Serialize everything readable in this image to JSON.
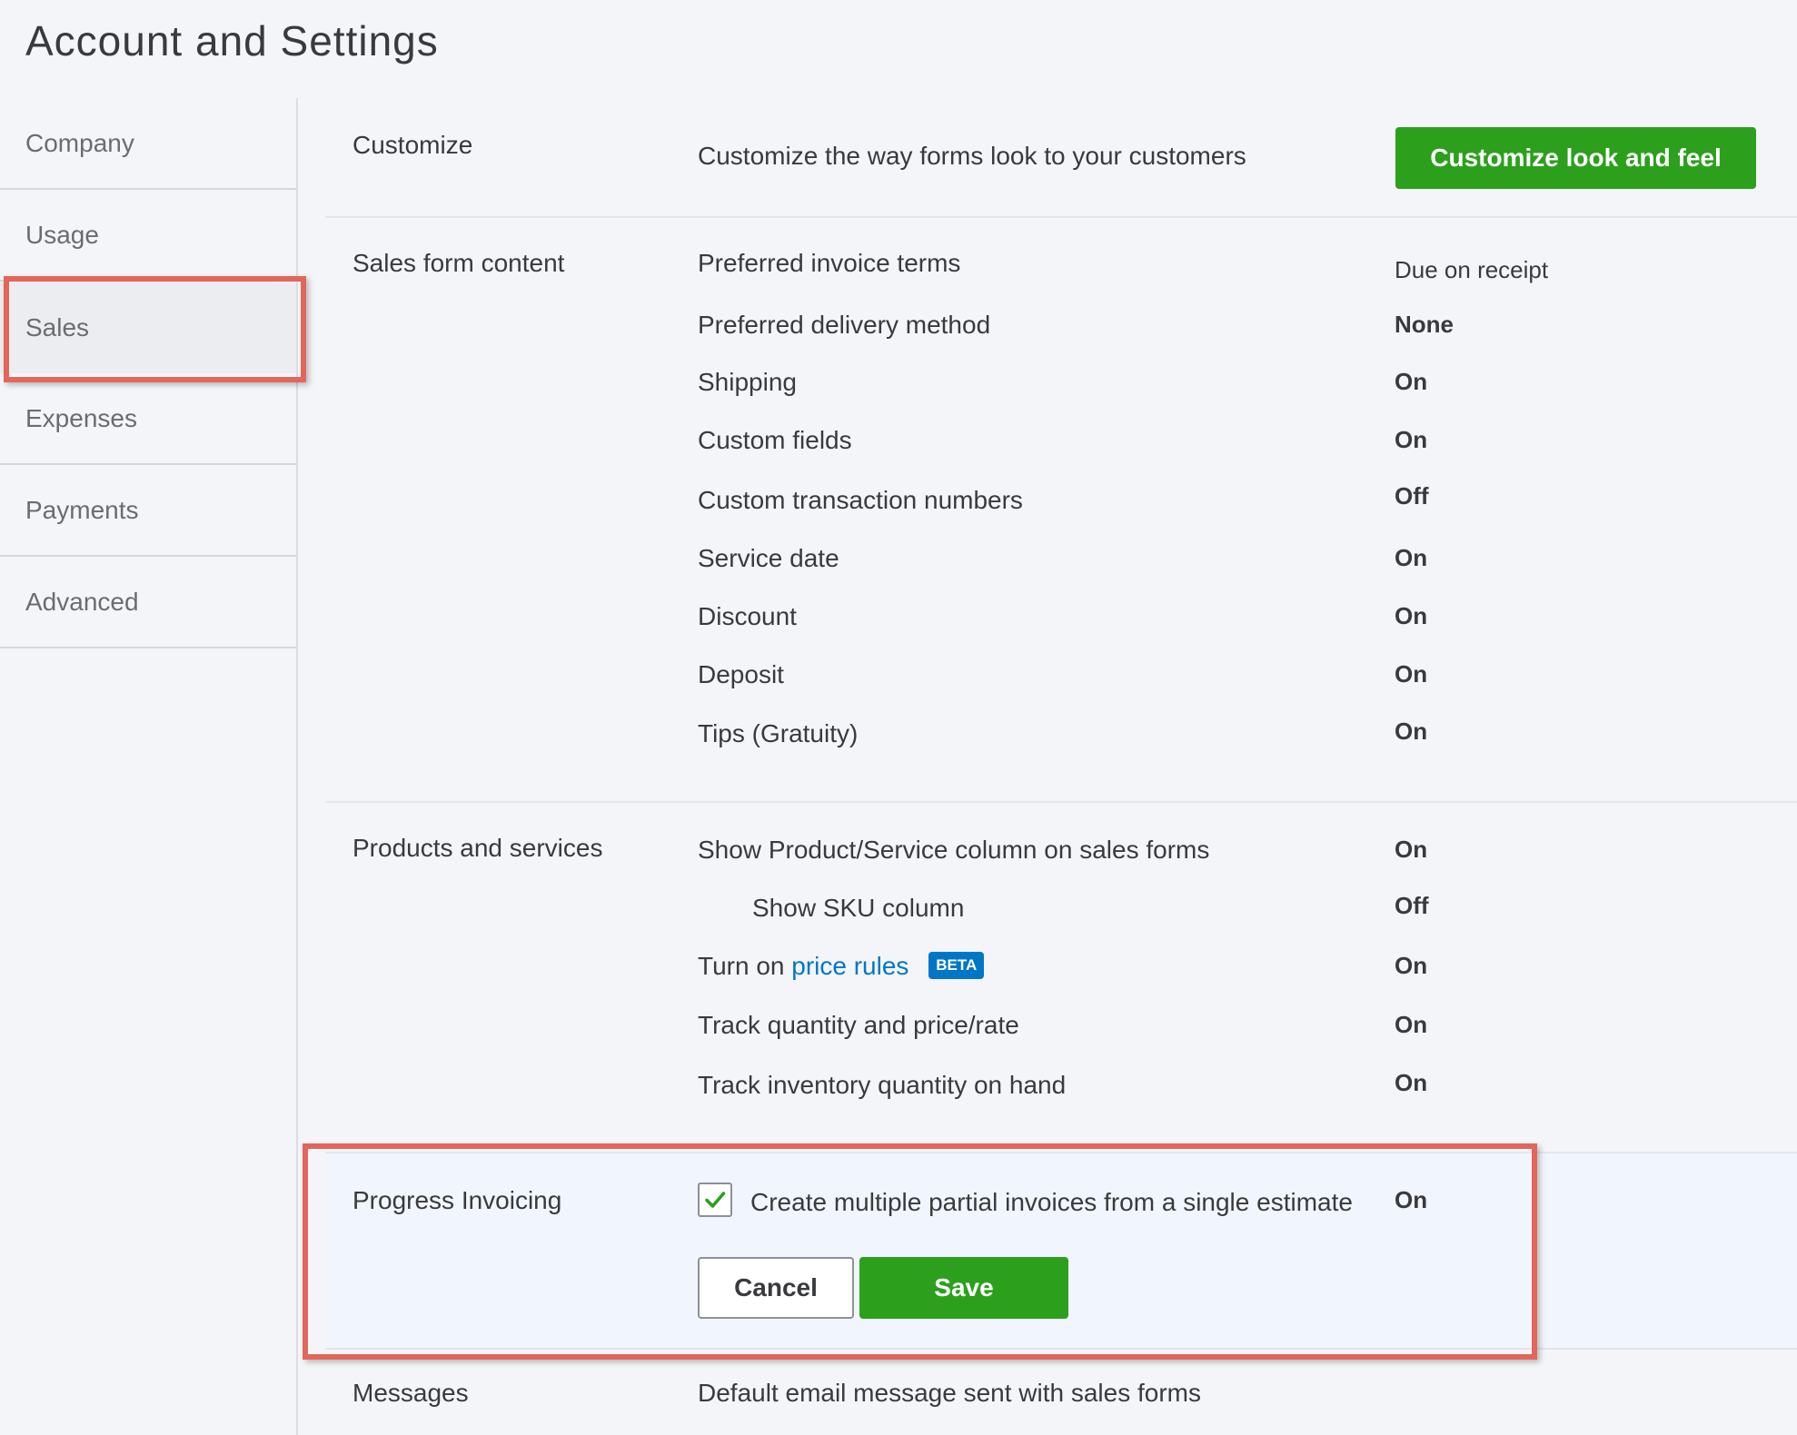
{
  "page_title": "Account and Settings",
  "sidebar": {
    "items": [
      {
        "label": "Company"
      },
      {
        "label": "Usage"
      },
      {
        "label": "Sales"
      },
      {
        "label": "Expenses"
      },
      {
        "label": "Payments"
      },
      {
        "label": "Advanced"
      }
    ],
    "active": "Sales"
  },
  "customize": {
    "title": "Customize",
    "description": "Customize the way forms look to your customers",
    "button_label": "Customize look and feel"
  },
  "sales_form_content": {
    "title": "Sales form content",
    "rows": [
      {
        "label": "Preferred invoice terms",
        "value": "Due on receipt"
      },
      {
        "label": "Preferred delivery method",
        "value": "None"
      },
      {
        "label": "Shipping",
        "value": "On"
      },
      {
        "label": "Custom fields",
        "value": "On"
      },
      {
        "label": "Custom transaction numbers",
        "value": "Off"
      },
      {
        "label": "Service date",
        "value": "On"
      },
      {
        "label": "Discount",
        "value": "On"
      },
      {
        "label": "Deposit",
        "value": "On"
      },
      {
        "label": "Tips (Gratuity)",
        "value": "On"
      }
    ]
  },
  "products_services": {
    "title": "Products and services",
    "rows": [
      {
        "label": "Show Product/Service column on sales forms",
        "value": "On"
      },
      {
        "label": "Show SKU column",
        "value": "Off"
      },
      {
        "label_prefix": "Turn on",
        "link": "price rules",
        "badge": "BETA",
        "value": "On"
      },
      {
        "label": "Track quantity and price/rate",
        "value": "On"
      },
      {
        "label": "Track inventory quantity on hand",
        "value": "On"
      }
    ]
  },
  "progress_invoicing": {
    "title": "Progress Invoicing",
    "checkbox_checked": true,
    "checkbox_label": "Create multiple partial invoices from a single estimate",
    "value": "On",
    "cancel_label": "Cancel",
    "save_label": "Save"
  },
  "messages": {
    "title": "Messages",
    "description": "Default email message sent with sales forms"
  },
  "colors": {
    "accent_green": "#2ca01c",
    "link_blue": "#0077c5",
    "highlight_red": "#e2665a"
  }
}
